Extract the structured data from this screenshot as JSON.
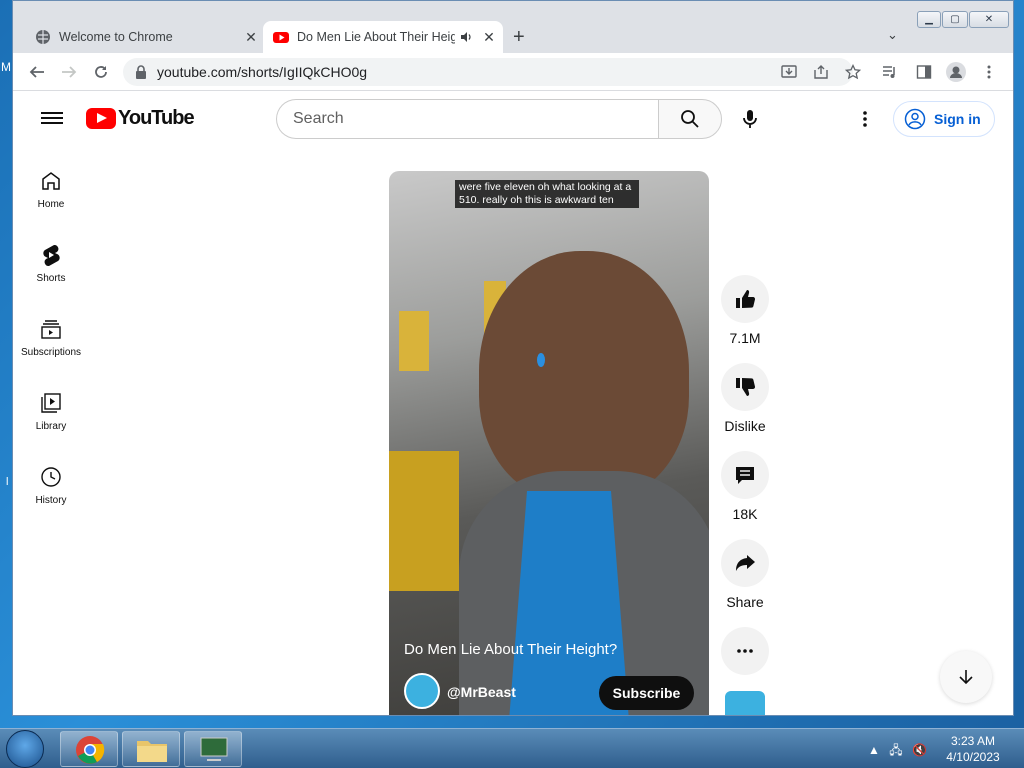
{
  "desktop": {
    "edge_text": "M",
    "edge_text2": "l"
  },
  "browser": {
    "tabs": [
      {
        "title": "Welcome to Chrome",
        "favicon": "chrome-globe-icon"
      },
      {
        "title": "Do Men Lie About Their Heig",
        "favicon": "youtube-icon",
        "audio": "speaker-icon"
      }
    ],
    "new_tab": "+",
    "url": "youtube.com/shorts/IgIIQkCHO0g"
  },
  "youtube": {
    "logo_text": "YouTube",
    "search_placeholder": "Search",
    "sign_in": "Sign in",
    "nav": [
      {
        "label": "Home",
        "icon": "home-icon"
      },
      {
        "label": "Shorts",
        "icon": "shorts-icon"
      },
      {
        "label": "Subscriptions",
        "icon": "subscriptions-icon"
      },
      {
        "label": "Library",
        "icon": "library-icon"
      },
      {
        "label": "History",
        "icon": "history-icon"
      }
    ],
    "short": {
      "caption": "were five eleven oh what looking at a 510. really oh this is awkward ten",
      "title": "Do Men Lie About Their Height?",
      "channel": "@MrBeast",
      "subscribe": "Subscribe"
    },
    "actions": {
      "likes": "7.1M",
      "dislike": "Dislike",
      "comments": "18K",
      "share": "Share"
    }
  },
  "taskbar": {
    "time": "3:23 AM",
    "date": "4/10/2023"
  },
  "colors": {
    "accent": "#065fd4",
    "brand": "#ff0000"
  }
}
